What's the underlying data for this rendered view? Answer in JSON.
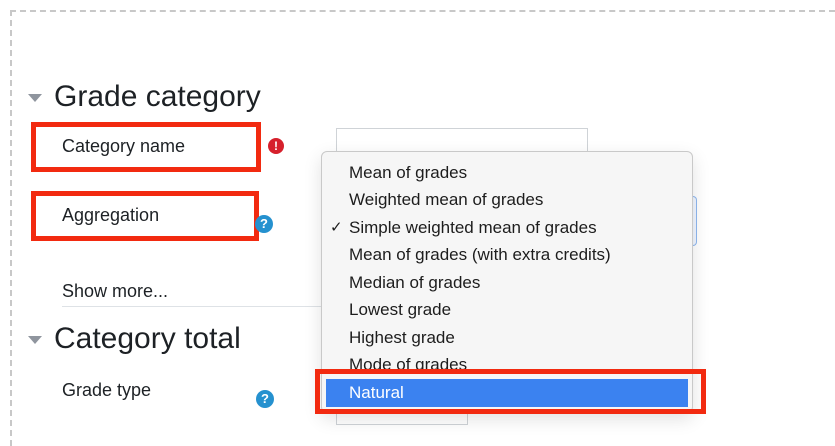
{
  "sections": {
    "grade_category": {
      "title": "Grade category",
      "category_name_label": "Category name",
      "required_icon": "exclamation-circle-icon",
      "aggregation_label": "Aggregation",
      "help_icon": "question-circle-icon",
      "show_more": "Show more..."
    },
    "category_total": {
      "title": "Category total",
      "grade_type_label": "Grade type",
      "help_icon": "question-circle-icon"
    }
  },
  "aggregation_dropdown": {
    "options": [
      "Mean of grades",
      "Weighted mean of grades",
      "Simple weighted mean of grades",
      "Mean of grades (with extra credits)",
      "Median of grades",
      "Lowest grade",
      "Highest grade",
      "Mode of grades",
      "Natural"
    ],
    "checked_option": "Simple weighted mean of grades",
    "highlighted_option": "Natural",
    "check_mark": "✓"
  },
  "colors": {
    "annotation_red": "#f22a10",
    "highlight_blue": "#3b82f0",
    "help_blue": "#2591cf",
    "error_red": "#d6202c"
  }
}
